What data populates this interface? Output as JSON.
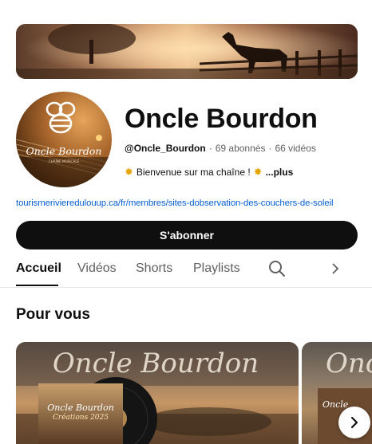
{
  "channel": {
    "name": "Oncle Bourdon",
    "handle": "@Oncle_Bourdon",
    "subscribers": "69 abonnés",
    "videos": "66 vidéos",
    "description": "Bienvenue sur ma chaîne !",
    "more_label": "...plus",
    "link": "tourismerivieredulouup.ca/fr/membres/sites-dobservation-des-couchers-de-soleil",
    "avatar_logo_text": "Oncle Bourdon",
    "avatar_sub_text": "CHAÎNE MUSICALE"
  },
  "subscribe_label": "S'abonner",
  "tabs": [
    {
      "label": "Accueil",
      "active": true
    },
    {
      "label": "Vidéos"
    },
    {
      "label": "Shorts"
    },
    {
      "label": "Playlists"
    }
  ],
  "icons": {
    "search": "search-icon",
    "chevron": "chevron-right-icon",
    "next": "chevron-right-icon",
    "sparkle": "sparkle-icon"
  },
  "section": {
    "title": "Pour vous"
  },
  "cards": [
    {
      "overlay_title": "Oncle Bourdon",
      "album_title": "Oncle Bourdon",
      "album_subtitle": "Créations 2025"
    },
    {
      "overlay_title": "Onc",
      "album_title": "Oncle"
    }
  ]
}
